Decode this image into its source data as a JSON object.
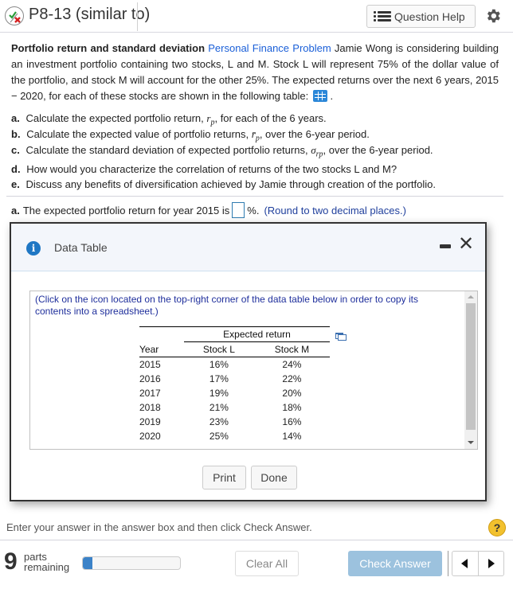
{
  "header": {
    "title": "P8-13 (similar to)",
    "status_icon": "partially-correct-icon",
    "question_help_label": "Question Help",
    "question_help_icon": "list-icon",
    "settings_icon": "gear-icon"
  },
  "problem": {
    "heading": "Portfolio return and standard deviation",
    "tag": "Personal Finance Problem",
    "text": "Jamie Wong is considering building an investment portfolio containing two stocks, L and M.  Stock L will represent 75% of the dollar value of the portfolio, and stock M will account for the other 25%.  The expected returns over the next 6 years, 2015 − 2020, for each of these stocks are shown in the following table:",
    "trailing": ".",
    "table_icon": "table-grid-icon"
  },
  "parts": [
    {
      "label": "a.",
      "before": "Calculate the expected portfolio return,",
      "symbol": "r",
      "sub": "p",
      "after": ", for each of the 6 years."
    },
    {
      "label": "b.",
      "before": "Calculate the expected value of portfolio returns,",
      "symbol": "r̄",
      "sub": "p",
      "after": ", over the 6-year period."
    },
    {
      "label": "c.",
      "before": "Calculate the standard deviation of expected portfolio returns,",
      "symbol": "σ",
      "sub": "rp",
      "after": ", over the 6-year period."
    },
    {
      "label": "d.",
      "text": "How would you characterize the correlation of returns of the two stocks L and M?"
    },
    {
      "label": "e.",
      "text": "Discuss any benefits of diversification achieved by Jamie through creation of the portfolio."
    }
  ],
  "answer": {
    "label": "a.",
    "prefix": "The expected portfolio return for year 2015 is",
    "value": "",
    "suffix": "%.",
    "hint": "(Round to two decimal places.)"
  },
  "modal": {
    "title": "Data Table",
    "instructions": "(Click on the icon located on the top-right corner of the data table below in order to copy its contents into a spreadsheet.)",
    "table": {
      "group_header": "Expected return",
      "columns": [
        "Year",
        "Stock L",
        "Stock M"
      ],
      "rows": [
        [
          "2015",
          "16%",
          "24%"
        ],
        [
          "2016",
          "17%",
          "22%"
        ],
        [
          "2017",
          "19%",
          "20%"
        ],
        [
          "2018",
          "21%",
          "18%"
        ],
        [
          "2019",
          "23%",
          "16%"
        ],
        [
          "2020",
          "25%",
          "14%"
        ]
      ]
    },
    "print_label": "Print",
    "done_label": "Done"
  },
  "footer": {
    "message": "Enter your answer in the answer box and then click Check Answer.",
    "help_label": "?",
    "parts_count": "9",
    "parts_line1": "parts",
    "parts_line2": "remaining",
    "progress_fraction": 0.1,
    "clear_all_label": "Clear All",
    "check_answer_label": "Check Answer"
  },
  "colors": {
    "accent_blue": "#1a5fd8",
    "hint_blue": "#1f3f9c",
    "check_button": "#9cc2de",
    "progress_fill": "#3b82c8",
    "help_yellow": "#f2c12e"
  }
}
